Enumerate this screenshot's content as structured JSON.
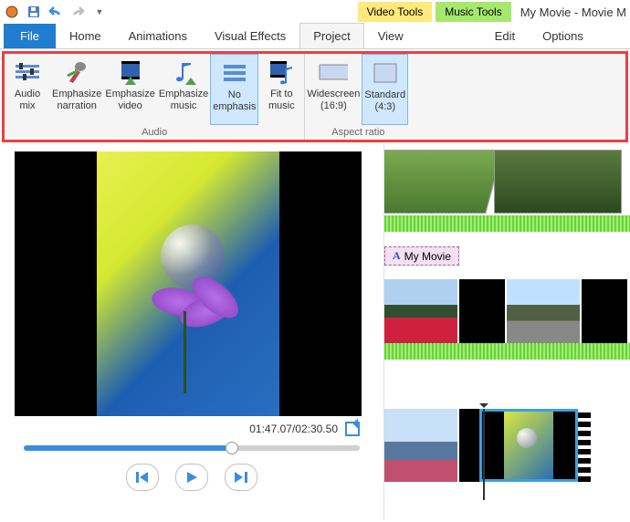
{
  "title": "My Movie - Movie M",
  "context_tabs": {
    "video": "Video Tools",
    "music": "Music Tools"
  },
  "tabs": {
    "file": "File",
    "home": "Home",
    "animations": "Animations",
    "visual_effects": "Visual Effects",
    "project": "Project",
    "view": "View",
    "edit": "Edit",
    "options": "Options"
  },
  "ribbon": {
    "audio_group": "Audio",
    "aspect_group": "Aspect ratio",
    "audio_mix": {
      "l1": "Audio",
      "l2": "mix"
    },
    "emph_narr": {
      "l1": "Emphasize",
      "l2": "narration"
    },
    "emph_video": {
      "l1": "Emphasize",
      "l2": "video"
    },
    "emph_music": {
      "l1": "Emphasize",
      "l2": "music"
    },
    "no_emph": {
      "l1": "No",
      "l2": "emphasis"
    },
    "fit_music": {
      "l1": "Fit to",
      "l2": "music"
    },
    "widescreen": {
      "l1": "Widescreen",
      "l2": "(16:9)"
    },
    "standard": {
      "l1": "Standard",
      "l2": "(4:3)"
    }
  },
  "preview": {
    "time": "01:47.07/02:30.50"
  },
  "timeline": {
    "title_text": "My Movie"
  }
}
